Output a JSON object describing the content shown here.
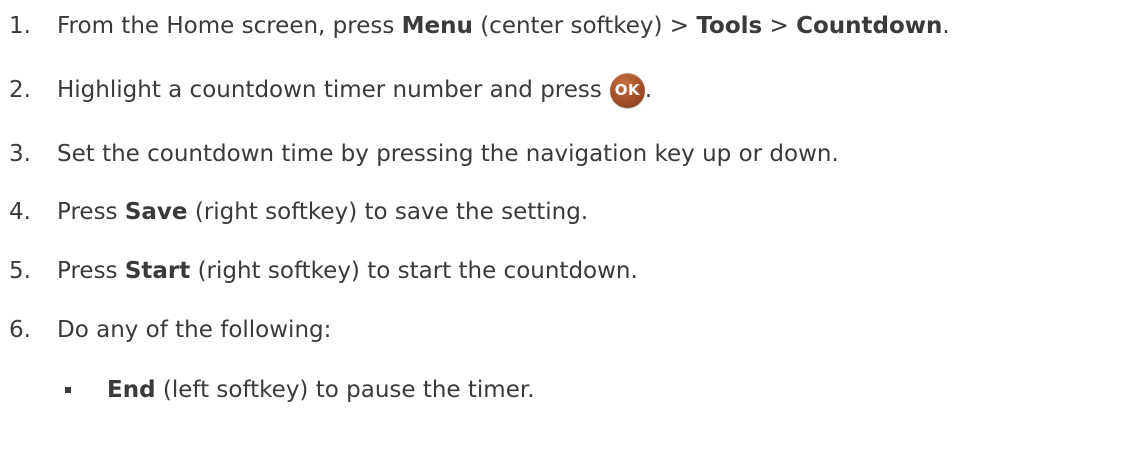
{
  "steps": [
    {
      "number": "1.",
      "p1": "From the Home screen, press ",
      "b1": "Menu",
      "p2": " (center softkey) > ",
      "b2": "Tools",
      "p3": " > ",
      "b3": "Countdown",
      "p4": "."
    },
    {
      "number": "2.",
      "p1": "Highlight a countdown timer number and press",
      "button_label": "OK",
      "p2": "."
    },
    {
      "number": "3.",
      "p1": "Set the countdown time by pressing the navigation key up or down."
    },
    {
      "number": "4.",
      "p1": "Press ",
      "b1": "Save",
      "p2": " (right softkey) to save the setting."
    },
    {
      "number": "5.",
      "p1": "Press ",
      "b1": "Start",
      "p2": " (right softkey) to start the countdown."
    },
    {
      "number": "6.",
      "p1": "Do any of the following:"
    }
  ],
  "sub_items": [
    {
      "b1": "End",
      "p1": " (left softkey) to pause the timer."
    }
  ],
  "colors": {
    "text": "#3a3a3a",
    "ok_button": "#a9532a"
  }
}
